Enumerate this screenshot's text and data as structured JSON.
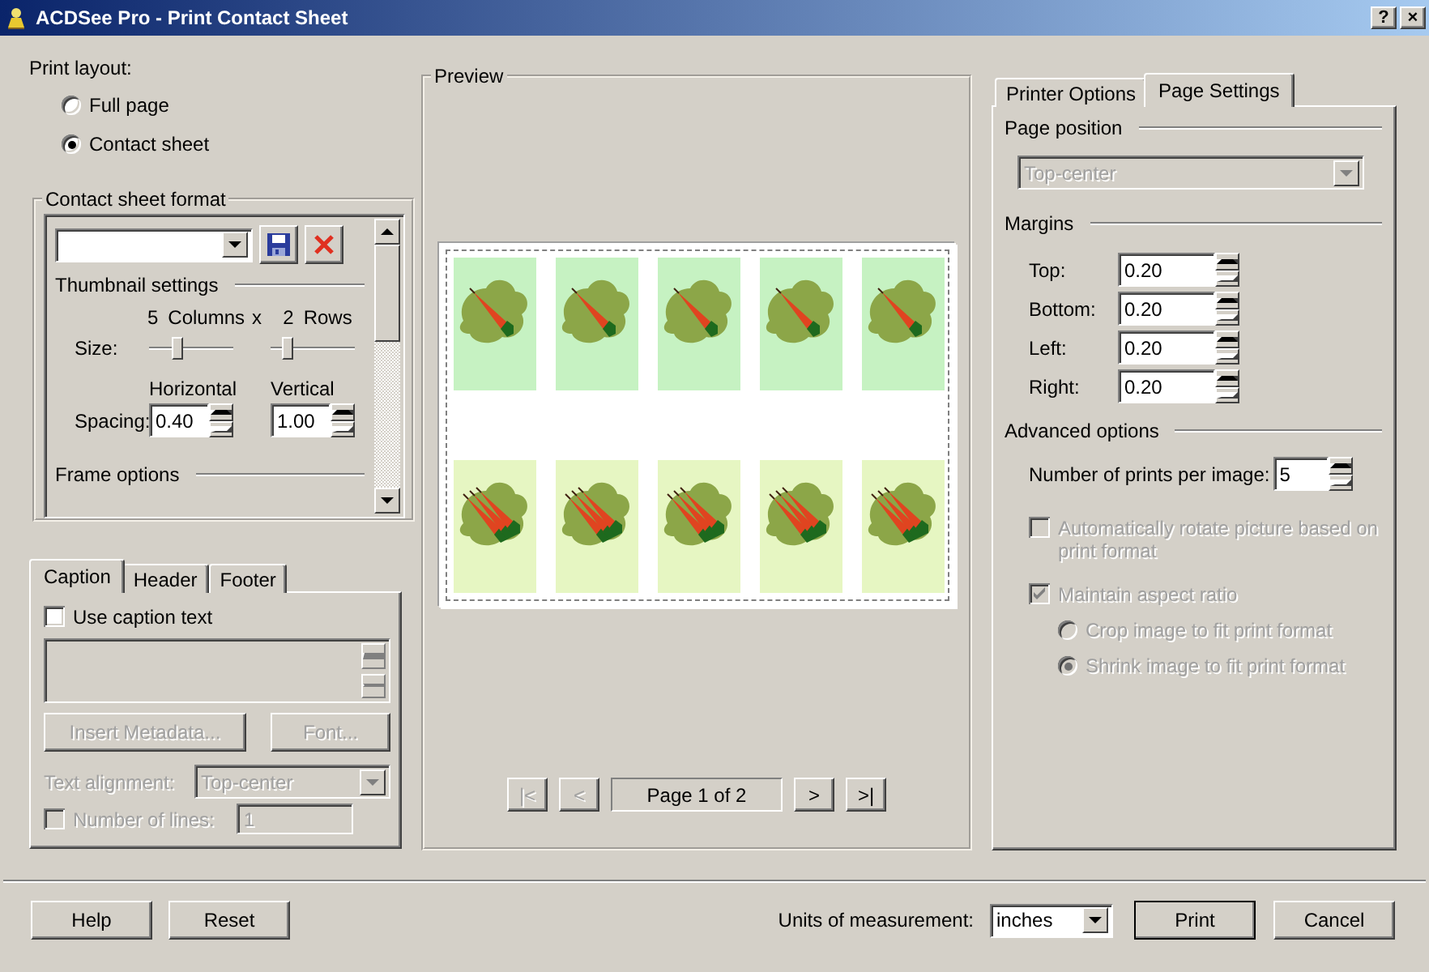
{
  "window": {
    "title": "ACDSee Pro - Print Contact Sheet",
    "help_button": "?",
    "close_button": "×"
  },
  "print_layout": {
    "label": "Print layout:",
    "options": [
      {
        "label": "Full page",
        "selected": false
      },
      {
        "label": "Contact sheet",
        "selected": true
      }
    ]
  },
  "contact_sheet_format": {
    "title": "Contact sheet format",
    "thumbnail_settings": "Thumbnail settings",
    "columns": "5",
    "columns_label": "Columns",
    "times": "x",
    "rows": "2",
    "rows_label": "Rows",
    "size_label": "Size:",
    "sliders": [
      {
        "level": 0.3
      },
      {
        "level": 0.15
      }
    ],
    "horizontal_label": "Horizontal",
    "vertical_label": "Vertical",
    "spacing_label": "Spacing:",
    "horizontal": "0.40",
    "vertical": "1.00",
    "frame_options": "Frame options"
  },
  "caption_tabs": {
    "tabs": [
      {
        "label": "Caption",
        "selected": true
      },
      {
        "label": "Header",
        "selected": false
      },
      {
        "label": "Footer",
        "selected": false
      }
    ],
    "use_caption": {
      "label": "Use caption text",
      "checked": false
    },
    "disabled": true,
    "insert_metadata": "Insert Metadata...",
    "font": "Font...",
    "text_alignment_label": "Text alignment:",
    "text_alignment": "Top-center",
    "number_of_lines": {
      "label": "Number of lines:",
      "checked": false,
      "value": "1"
    }
  },
  "preview": {
    "title": "Preview",
    "thumbnails": [
      {
        "kind": "single",
        "color": "#c6f2c2"
      },
      {
        "kind": "single",
        "color": "#c6f2c2"
      },
      {
        "kind": "single",
        "color": "#c6f2c2"
      },
      {
        "kind": "single",
        "color": "#c6f2c2"
      },
      {
        "kind": "single",
        "color": "#c6f2c2"
      },
      {
        "kind": "bunch",
        "color": "#e6f6c2"
      },
      {
        "kind": "bunch",
        "color": "#e6f6c2"
      },
      {
        "kind": "bunch",
        "color": "#e6f6c2"
      },
      {
        "kind": "bunch",
        "color": "#e6f6c2"
      },
      {
        "kind": "bunch",
        "color": "#e6f6c2"
      }
    ],
    "navigation": [
      {
        "label": "|<",
        "disabled": true
      },
      {
        "label": "<",
        "disabled": true
      },
      {
        "label": ">",
        "disabled": false
      },
      {
        "label": ">|",
        "disabled": false
      }
    ],
    "page_indicator": "Page 1 of 2"
  },
  "settings_tabs": {
    "tabs": [
      {
        "label": "Printer Options",
        "selected": false
      },
      {
        "label": "Page Settings",
        "selected": true
      }
    ],
    "page_position_heading": "Page position",
    "page_position": {
      "value": "Top-center",
      "disabled": true
    },
    "margins_heading": "Margins",
    "margins": [
      {
        "label": "Top:",
        "value": "0.20"
      },
      {
        "label": "Bottom:",
        "value": "0.20"
      },
      {
        "label": "Left:",
        "value": "0.20"
      },
      {
        "label": "Right:",
        "value": "0.20"
      }
    ],
    "advanced_heading": "Advanced options",
    "prints_label": "Number of prints per image:",
    "prints": "5",
    "options": [
      {
        "kind": "checkbox",
        "label": "Automatically rotate picture based on print format",
        "checked": false,
        "disabled": true
      },
      {
        "kind": "checkbox",
        "label": "Maintain aspect ratio",
        "checked": true,
        "disabled": true
      },
      {
        "kind": "radio",
        "label": "Crop image to fit print format",
        "selected": false,
        "disabled": true
      },
      {
        "kind": "radio",
        "label": "Shrink image to fit print format",
        "selected": true,
        "disabled": true
      }
    ]
  },
  "footer": {
    "help": "Help",
    "reset": "Reset",
    "units_label": "Units of measurement:",
    "units": "inches",
    "print": "Print",
    "cancel": "Cancel"
  }
}
